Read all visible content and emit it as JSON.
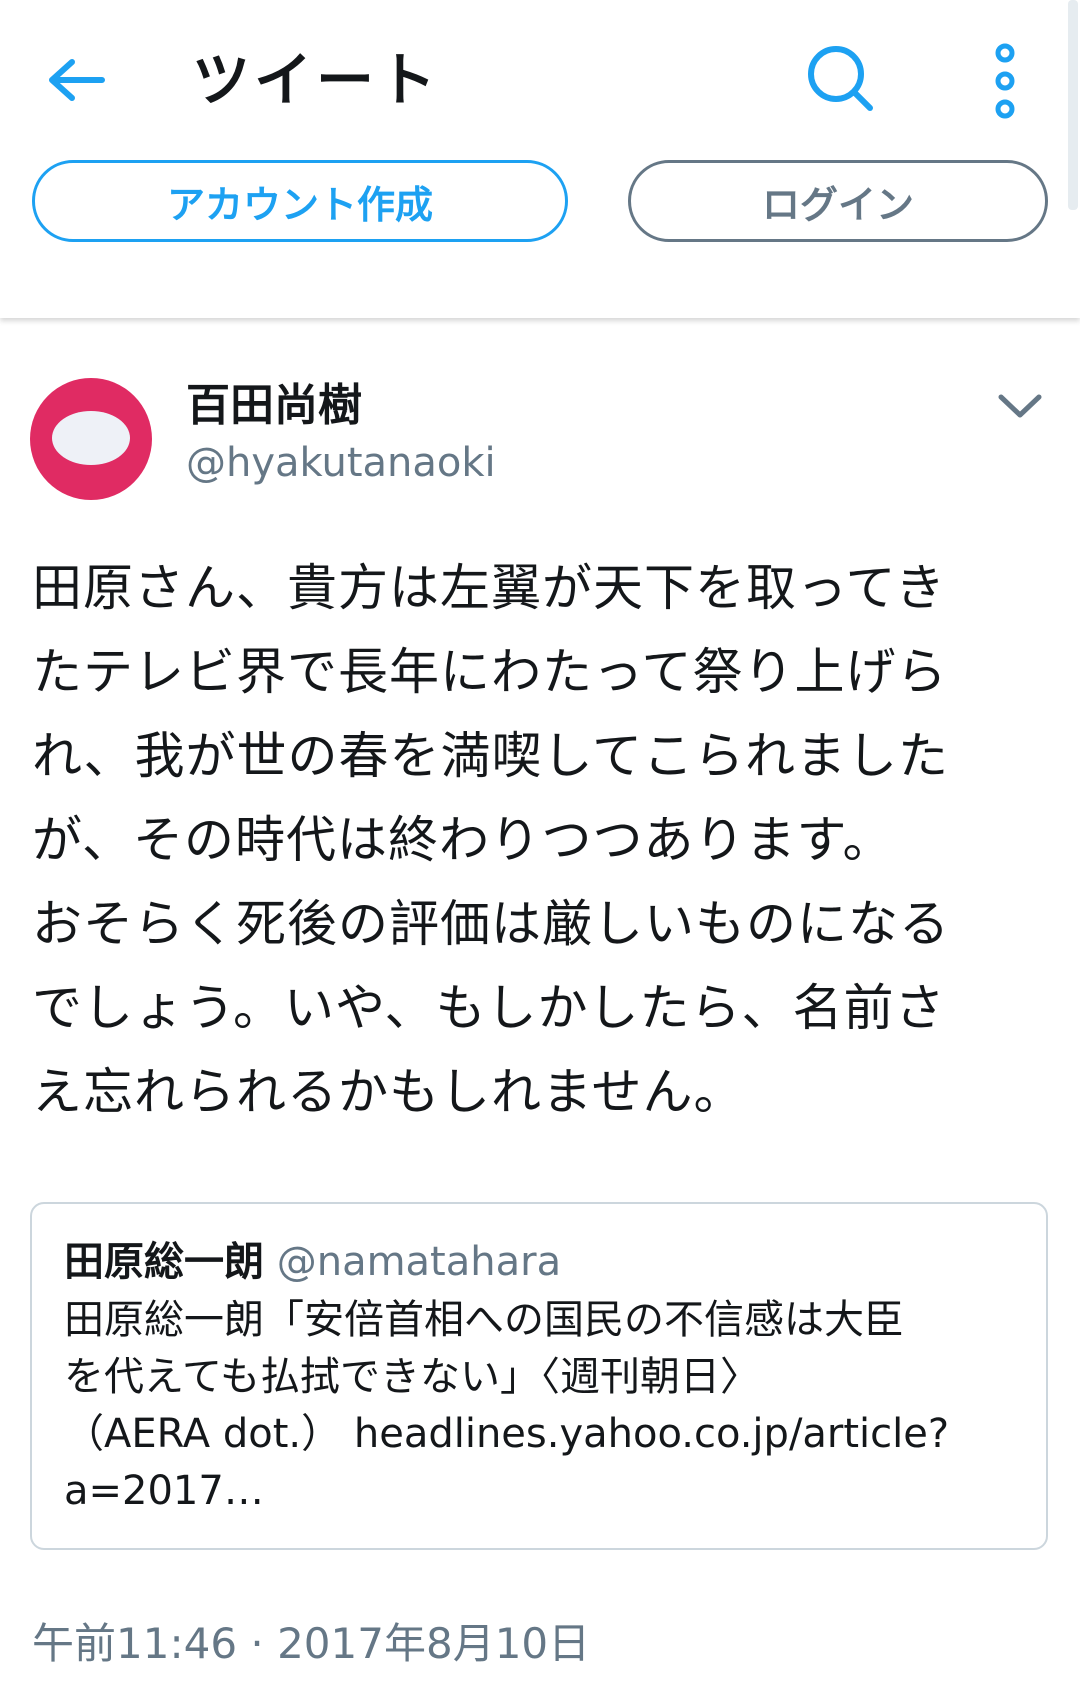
{
  "header": {
    "title": "ツイート",
    "icons": {
      "back": "arrow-left-icon",
      "search": "search-icon",
      "more": "more-vertical-icon"
    }
  },
  "actions": {
    "signup_label": "アカウント作成",
    "login_label": "ログイン"
  },
  "tweet": {
    "display_name": "百田尚樹",
    "handle": "@hyakutanaoki",
    "text_lines": [
      "田原さん、貴方は左翼が天下を取ってき",
      "たテレビ界で長年にわたって祭り上げら",
      "れ、我が世の春を満喫してこられました",
      "が、その時代は終わりつつあります。",
      "おそらく死後の評価は厳しいものになる",
      "でしょう。いや、もしかしたら、名前さ",
      "え忘れられるかもしれません。"
    ],
    "timestamp": "午前11:46 · 2017年8月10日"
  },
  "quoted_tweet": {
    "display_name": "田原総一朗",
    "handle": "@namatahara",
    "text_lines": [
      "田原総一朗「安倍首相への国民の不信感は大臣",
      "を代えても払拭できない」〈週刊朝日〉",
      "（AERA dot.） headlines.yahoo.co.jp/article?",
      "a=2017…"
    ]
  },
  "colors": {
    "accent": "#1da1f2",
    "secondary_text": "#657786",
    "primary_text": "#14171a",
    "avatar_bg": "#e02b63",
    "card_border": "#ccd6dd"
  }
}
